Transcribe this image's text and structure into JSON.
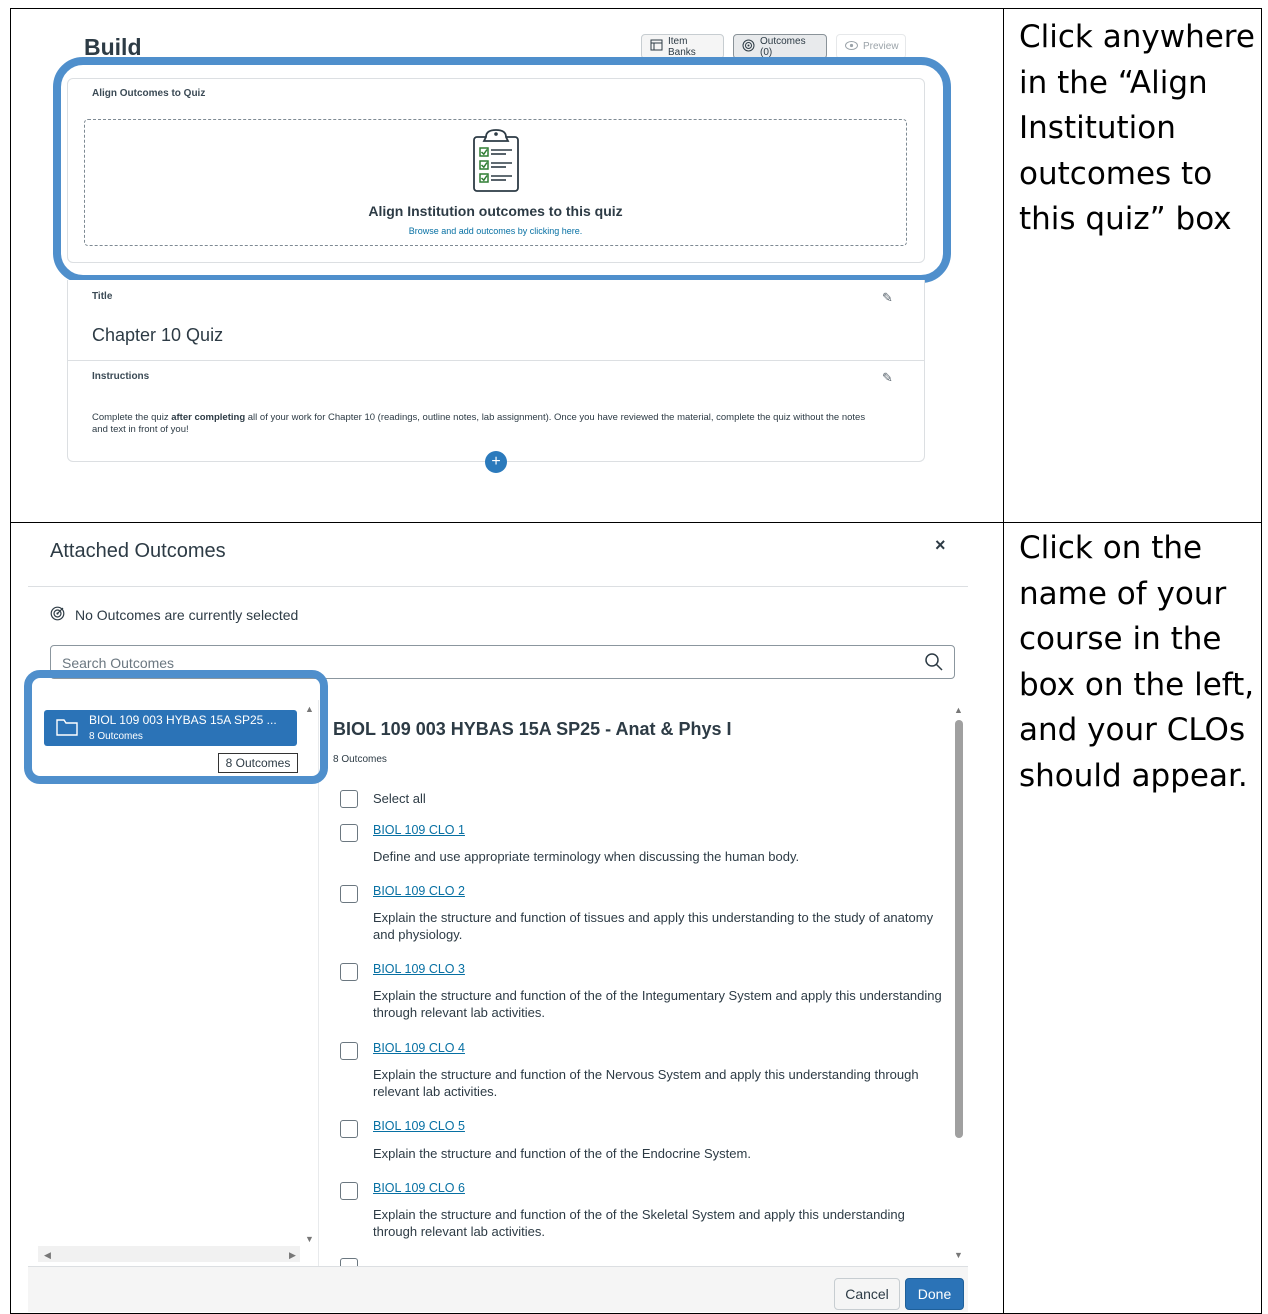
{
  "instructions": {
    "step1": [
      "Click anywhere",
      "in the “Align",
      "Institution",
      "outcomes to",
      "this quiz” box"
    ],
    "step2": [
      "Click on the",
      "name of your",
      "course in the",
      "box on the left,",
      "and your CLOs",
      "should appear."
    ]
  },
  "build": {
    "title": "Build",
    "toolbar": {
      "item_banks": "Item Banks",
      "outcomes": "Outcomes (0)",
      "preview": "Preview"
    },
    "align_card": {
      "label": "Align Outcomes to Quiz",
      "main_text": "Align Institution outcomes to this quiz",
      "sub_text": "Browse and add outcomes by clicking here."
    },
    "title_label": "Title",
    "quiz_title": "Chapter 10 Quiz",
    "instructions_label": "Instructions",
    "instructions_pre": "Complete the quiz ",
    "instructions_bold": "after completing",
    "instructions_post": " all of your work for Chapter 10 (readings, outline notes, lab assignment).  Once you have reviewed the material, complete the quiz without the notes and text in front of you!",
    "add_button": "+"
  },
  "modal": {
    "title": "Attached Outcomes",
    "close": "×",
    "none_selected": "No Outcomes are currently selected",
    "search_placeholder": "Search Outcomes",
    "folder": {
      "name": "BIOL 109 003 HYBAS 15A SP25 ...",
      "count": "8 Outcomes",
      "tooltip": "8 Outcomes"
    },
    "group_title": "BIOL 109 003 HYBAS 15A SP25 - Anat & Phys I",
    "group_count": "8 Outcomes",
    "select_all": "Select all",
    "outcomes": [
      {
        "name": "BIOL 109 CLO 1",
        "desc": "Define and use appropriate terminology when discussing the human body."
      },
      {
        "name": "BIOL 109 CLO 2",
        "desc": "Explain the structure and function of tissues and apply this understanding to the study of anatomy and physiology."
      },
      {
        "name": "BIOL 109 CLO 3",
        "desc": "Explain the structure and function of the of the Integumentary System and apply this understanding through relevant lab activities."
      },
      {
        "name": "BIOL 109 CLO 4",
        "desc": "Explain the structure and function of the Nervous System and apply this understanding through relevant lab activities."
      },
      {
        "name": "BIOL 109 CLO 5",
        "desc": "Explain the structure and function of the of the Endocrine System."
      },
      {
        "name": "BIOL 109 CLO 6",
        "desc": "Explain the structure and function of the of the Skeletal System and apply this understanding through relevant lab activities."
      }
    ],
    "cancel": "Cancel",
    "done": "Done"
  },
  "colors": {
    "highlight": "#4f8fcc",
    "brand": "#2b73b7",
    "link": "#0770a3",
    "text": "#2d3b45"
  },
  "icons": [
    "item-banks-icon",
    "outcomes-target-icon",
    "preview-eye-icon",
    "clipboard-checklist-icon",
    "pencil-icon",
    "plus-icon",
    "close-icon",
    "target-icon",
    "search-icon",
    "folder-icon"
  ]
}
